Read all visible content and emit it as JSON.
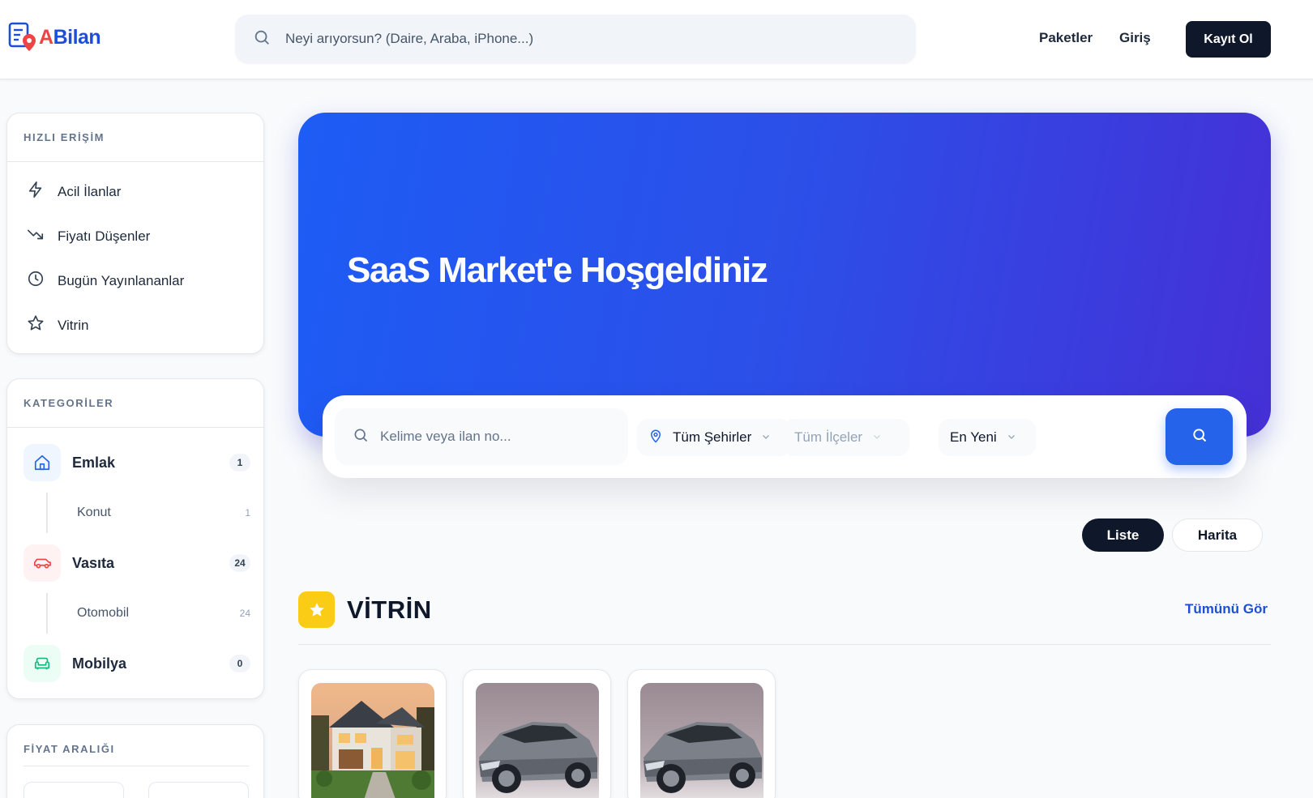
{
  "header": {
    "logo_text": "ABilan",
    "logo_first_letter": "A",
    "logo_rest": "Bilan",
    "search_placeholder": "Neyi arıyorsun? (Daire, Araba, iPhone...)",
    "nav": {
      "packages": "Paketler",
      "login": "Giriş",
      "signup": "Kayıt Ol"
    }
  },
  "sidebar": {
    "quick_access": {
      "title": "HIZLI ERİŞİM",
      "items": [
        {
          "label": "Acil İlanlar",
          "icon": "lightning-icon"
        },
        {
          "label": "Fiyatı Düşenler",
          "icon": "trending-down-icon"
        },
        {
          "label": "Bugün Yayınlananlar",
          "icon": "clock-icon"
        },
        {
          "label": "Vitrin",
          "icon": "star-icon"
        }
      ]
    },
    "categories": {
      "title": "KATEGORİLER",
      "items": [
        {
          "label": "Emlak",
          "count": "1",
          "icon": "home-icon",
          "color": "#2563eb",
          "bg": "#eff6ff",
          "sub": {
            "label": "Konut",
            "count": "1"
          }
        },
        {
          "label": "Vasıta",
          "count": "24",
          "icon": "car-icon",
          "color": "#ef4444",
          "bg": "#fef2f2",
          "sub": {
            "label": "Otomobil",
            "count": "24"
          }
        },
        {
          "label": "Mobilya",
          "count": "0",
          "icon": "sofa-icon",
          "color": "#10b981",
          "bg": "#ecfdf5"
        }
      ]
    },
    "price_range": {
      "title": "FİYAT ARALIĞI"
    }
  },
  "hero": {
    "title": "SaaS Market'e Hoşgeldiniz"
  },
  "filters": {
    "keyword_placeholder": "Kelime veya ilan no...",
    "city": "Tüm Şehirler",
    "district": "Tüm İlçeler",
    "sort": "En Yeni"
  },
  "view_toggle": {
    "list": "Liste",
    "map": "Harita",
    "active": "list"
  },
  "showcase": {
    "title": "VİTRİN",
    "see_all": "Tümünü Gör",
    "listings": [
      {
        "image": "house-photo"
      },
      {
        "image": "car-photo"
      },
      {
        "image": "car-photo"
      }
    ]
  },
  "colors": {
    "brand_blue": "#1d4ed8",
    "brand_red": "#ef4444",
    "dark": "#0f172a",
    "hero_start": "#1d5cf5",
    "hero_end": "#4530d6",
    "accent_yellow": "#facc15"
  }
}
